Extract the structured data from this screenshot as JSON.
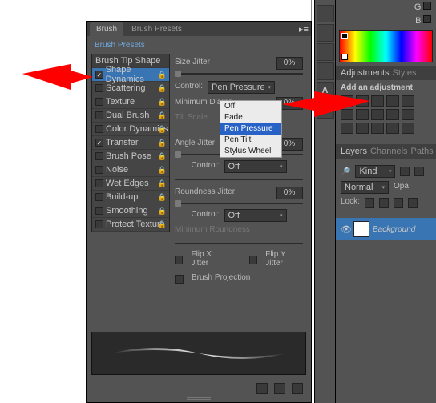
{
  "brush_panel": {
    "tabs": [
      "Brush",
      "Brush Presets"
    ],
    "presets_link": "Brush Presets",
    "size_jitter_label": "Size Jitter",
    "size_jitter_value": "0%",
    "control_label": "Control:",
    "control_value": "Pen Pressure",
    "dropdown_options": [
      "Off",
      "Fade",
      "Pen Pressure",
      "Pen Tilt",
      "Stylus Wheel"
    ],
    "min_diameter_label": "Minimum Diame",
    "min_diameter_value": "0%",
    "tilt_scale_label": "Tilt Scale",
    "angle_jitter_label": "Angle Jitter",
    "angle_jitter_value": "0%",
    "control2_value": "Off",
    "roundness_label": "Roundness Jitter",
    "roundness_value": "0%",
    "control3_value": "Off",
    "min_roundness_label": "Minimum Roundness",
    "flip_x": "Flip X Jitter",
    "flip_y": "Flip Y Jitter",
    "brush_projection": "Brush Projection",
    "side_items": [
      {
        "label": "Brush Tip Shape",
        "check": null
      },
      {
        "label": "Shape Dynamics",
        "check": true,
        "selected": true
      },
      {
        "label": "Scattering",
        "check": false
      },
      {
        "label": "Texture",
        "check": false
      },
      {
        "label": "Dual Brush",
        "check": false
      },
      {
        "label": "Color Dynamics",
        "check": false
      },
      {
        "label": "Transfer",
        "check": true
      },
      {
        "label": "Brush Pose",
        "check": false
      },
      {
        "label": "Noise",
        "check": false
      },
      {
        "label": "Wet Edges",
        "check": false
      },
      {
        "label": "Build-up",
        "check": false
      },
      {
        "label": "Smoothing",
        "check": false
      },
      {
        "label": "Protect Texture",
        "check": false
      }
    ]
  },
  "color": {
    "g": "G",
    "b": "B"
  },
  "adjustments": {
    "tabs": [
      "Adjustments",
      "Styles"
    ],
    "title": "Add an adjustment"
  },
  "layers": {
    "tabs": [
      "Layers",
      "Channels",
      "Paths"
    ],
    "kind": "Kind",
    "blend": "Normal",
    "opacity_label": "Opa",
    "lock_label": "Lock:",
    "bg_name": "Background"
  }
}
